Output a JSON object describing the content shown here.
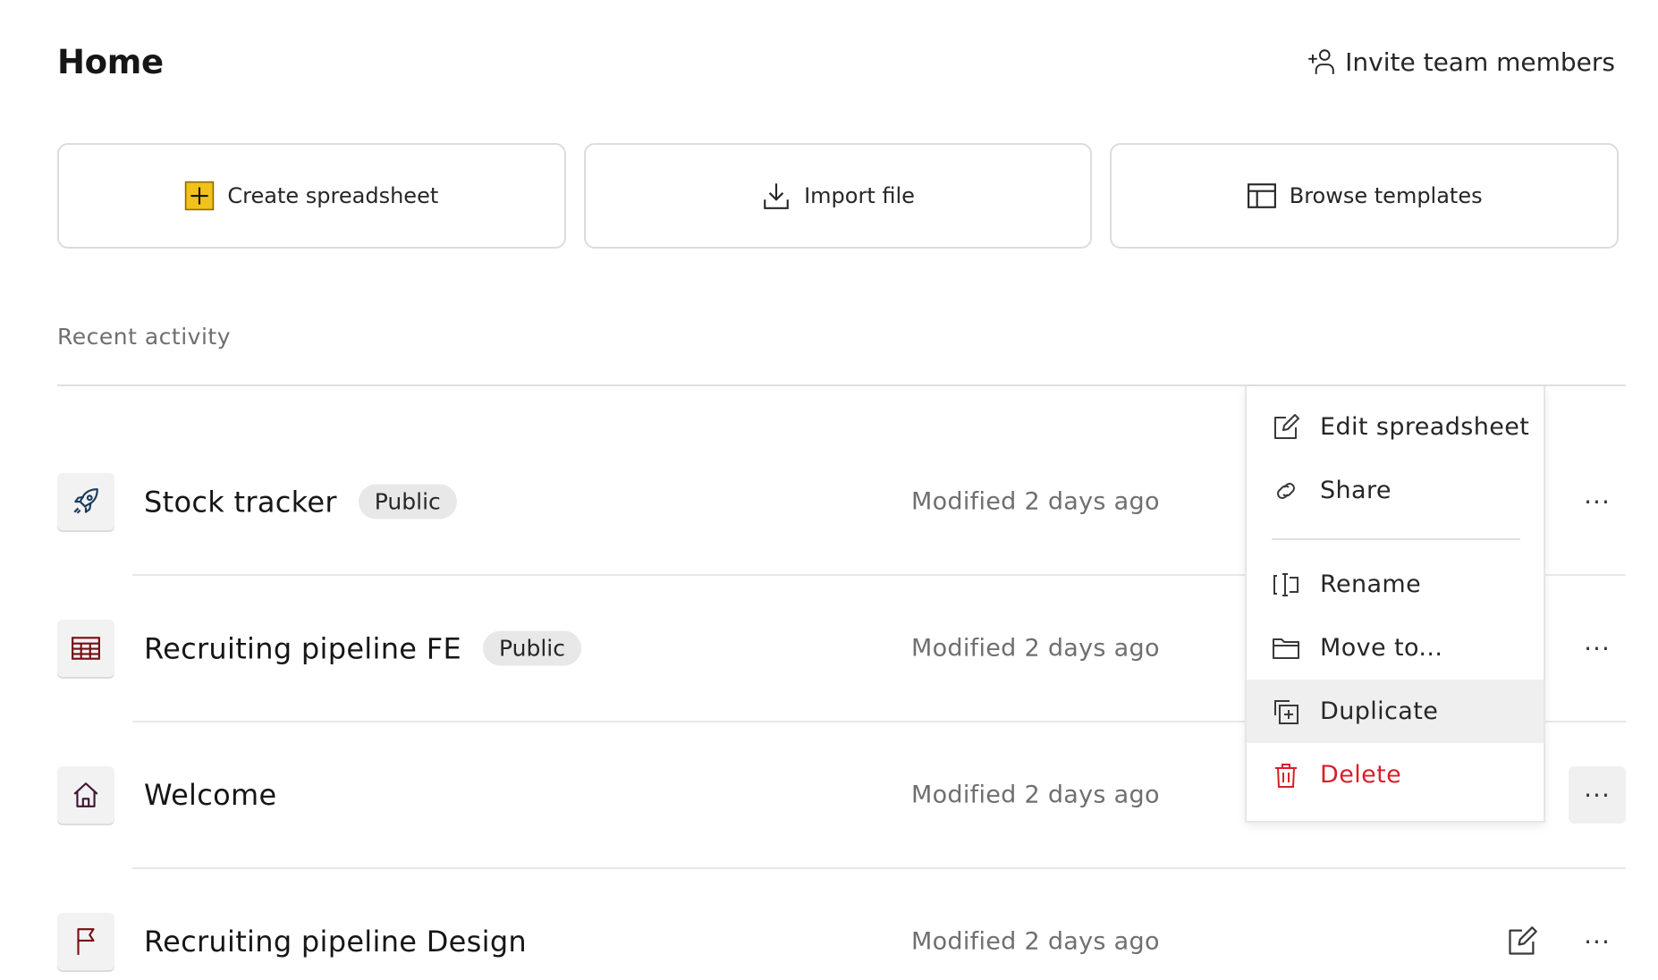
{
  "header": {
    "title": "Home",
    "invite_label": "Invite team members"
  },
  "actions": [
    {
      "label": "Create spreadsheet",
      "icon": "plus-square-icon"
    },
    {
      "label": "Import file",
      "icon": "download-icon"
    },
    {
      "label": "Browse templates",
      "icon": "template-icon"
    }
  ],
  "recent": {
    "label": "Recent activity",
    "rows": [
      {
        "name": "Stock tracker",
        "badge": "Public",
        "modified": "Modified 2 days ago",
        "icon": "rocket-icon"
      },
      {
        "name": "Recruiting pipeline FE",
        "badge": "Public",
        "modified": "Modified 2 days ago",
        "icon": "table-icon"
      },
      {
        "name": "Welcome",
        "badge": "",
        "modified": "Modified 2 days ago",
        "icon": "home-icon"
      },
      {
        "name": "Recruiting pipeline Design",
        "badge": "",
        "modified": "Modified 2 days ago",
        "icon": "flag-icon"
      }
    ],
    "more_label": "···"
  },
  "context_menu": {
    "items": [
      {
        "label": "Edit spreadsheet",
        "icon": "edit-icon"
      },
      {
        "label": "Share",
        "icon": "link-icon"
      },
      {
        "label": "Rename",
        "icon": "rename-icon"
      },
      {
        "label": "Move to...",
        "icon": "folder-icon"
      },
      {
        "label": "Duplicate",
        "icon": "duplicate-icon",
        "hovered": true
      },
      {
        "label": "Delete",
        "icon": "trash-icon",
        "danger": true
      }
    ]
  },
  "colors": {
    "accent_yellow": "#f1c21b",
    "danger": "#da1e28",
    "muted_text": "#6f6f6f",
    "icon_dark_red": "#750e13",
    "icon_navy": "#1c3a5e"
  }
}
